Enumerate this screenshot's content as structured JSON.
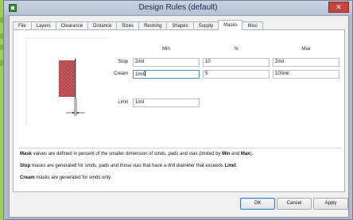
{
  "window": {
    "title": "Design Rules (default)",
    "close_glyph": "✕",
    "app_icon": "eagle-drc-icon"
  },
  "tabs": [
    {
      "label": "File",
      "active": false
    },
    {
      "label": "Layers",
      "active": false
    },
    {
      "label": "Clearance",
      "active": false
    },
    {
      "label": "Distance",
      "active": false
    },
    {
      "label": "Sizes",
      "active": false
    },
    {
      "label": "Restring",
      "active": false
    },
    {
      "label": "Shapes",
      "active": false
    },
    {
      "label": "Supply",
      "active": false
    },
    {
      "label": "Masks",
      "active": true
    },
    {
      "label": "Misc",
      "active": false
    }
  ],
  "masks": {
    "headers": {
      "min": "Min",
      "percent": "%",
      "max": "Max"
    },
    "stop": {
      "label": "Stop",
      "min": "2mil",
      "percent": "10",
      "max": "2mil"
    },
    "cream": {
      "label": "Cream",
      "min": "1mil",
      "percent": "5",
      "max": "100mil"
    },
    "limit": {
      "label": "Limit",
      "value": "1mil"
    }
  },
  "description": {
    "line1": {
      "t1": "Mask",
      "t2": " values are defined in percent of the smaller dimension of smds, pads and vias (limited by ",
      "t3": "Min",
      "t4": " and ",
      "t5": "Max",
      "t6": ")."
    },
    "line2": {
      "t1": "Stop",
      "t2": " masks are generated for smds, pads and those vias that have a drill diameter that exceeds ",
      "t3": "Limit",
      "t4": "."
    },
    "line3": {
      "t1": "Cream",
      "t2": " masks are generated for smds only."
    }
  },
  "buttons": {
    "ok": "OK",
    "cancel": "Cancel",
    "apply": "Apply"
  },
  "colors": {
    "pad_fill": "#c85a5a",
    "pad_hatch": "#8a2a2a",
    "accent": "#3c7fd1",
    "taskbar_green": "#9ed04a"
  }
}
